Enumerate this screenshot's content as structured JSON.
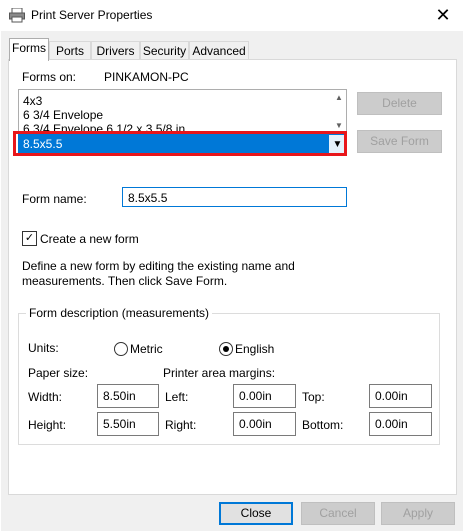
{
  "window": {
    "title": "Print Server Properties",
    "close_glyph": "✕"
  },
  "tabs": [
    "Forms",
    "Ports",
    "Drivers",
    "Security",
    "Advanced"
  ],
  "forms_on": {
    "label": "Forms on:",
    "value": "PINKAMON-PC"
  },
  "forms_list": {
    "items": [
      "4x3",
      "6 3/4 Envelope",
      "6 3/4 Envelope 6 1/2 x 3 5/8 in"
    ],
    "selected": "8.5x5.5"
  },
  "buttons": {
    "delete": "Delete",
    "save_form": "Save Form",
    "close": "Close",
    "cancel": "Cancel",
    "apply": "Apply"
  },
  "form_name": {
    "label": "Form name:",
    "value": "8.5x5.5"
  },
  "create_new": {
    "label": "Create a new form",
    "checked": true,
    "check_glyph": "✓"
  },
  "description": "Define a new form by editing the existing name and measurements. Then click Save Form.",
  "measurements": {
    "title": "Form description (measurements)",
    "units_label": "Units:",
    "metric": "Metric",
    "english": "English",
    "selected_unit": "English",
    "paper_size": "Paper size:",
    "printer_margins": "Printer area margins:",
    "width_label": "Width:",
    "width": "8.50in",
    "height_label": "Height:",
    "height": "5.50in",
    "left_label": "Left:",
    "left": "0.00in",
    "right_label": "Right:",
    "right": "0.00in",
    "top_label": "Top:",
    "top": "0.00in",
    "bottom_label": "Bottom:",
    "bottom": "0.00in"
  },
  "colors": {
    "accent": "#0078d7",
    "highlight_border": "#e8161b"
  }
}
